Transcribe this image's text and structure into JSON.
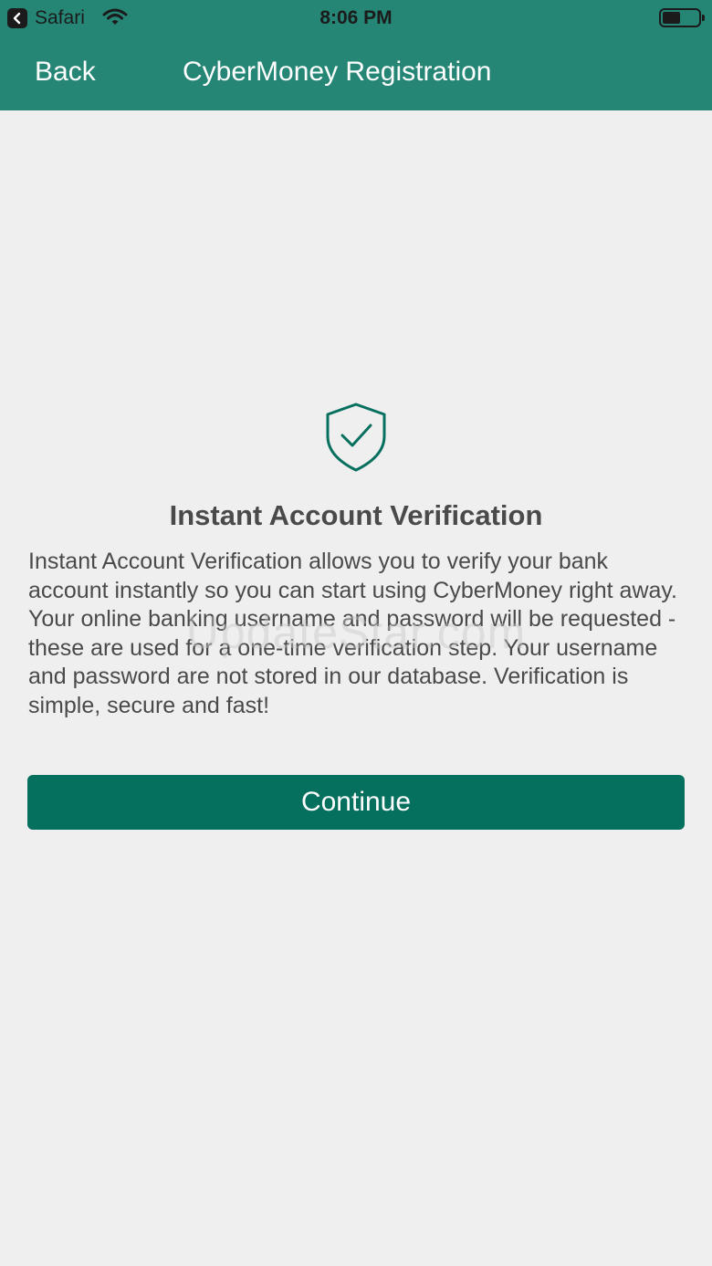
{
  "status_bar": {
    "back_app_label": "Safari",
    "time": "8:06 PM",
    "battery_level": 0.5
  },
  "nav": {
    "back_label": "Back",
    "title": "CyberMoney Registration"
  },
  "content": {
    "icon": "shield-check-icon",
    "heading": "Instant Account Verification",
    "description": "Instant Account Verification allows you to verify your bank account instantly so you can start using CyberMoney right away.  Your online banking username and password will be requested - these are used for a one-time verification step. Your username and password are not stored in our database. Verification is simple, secure and fast!",
    "continue_label": "Continue"
  },
  "watermark": "UpdateStar.com",
  "colors": {
    "header": "#268676",
    "button": "#06705f",
    "background": "#efefef",
    "text": "#4a4a4a"
  }
}
